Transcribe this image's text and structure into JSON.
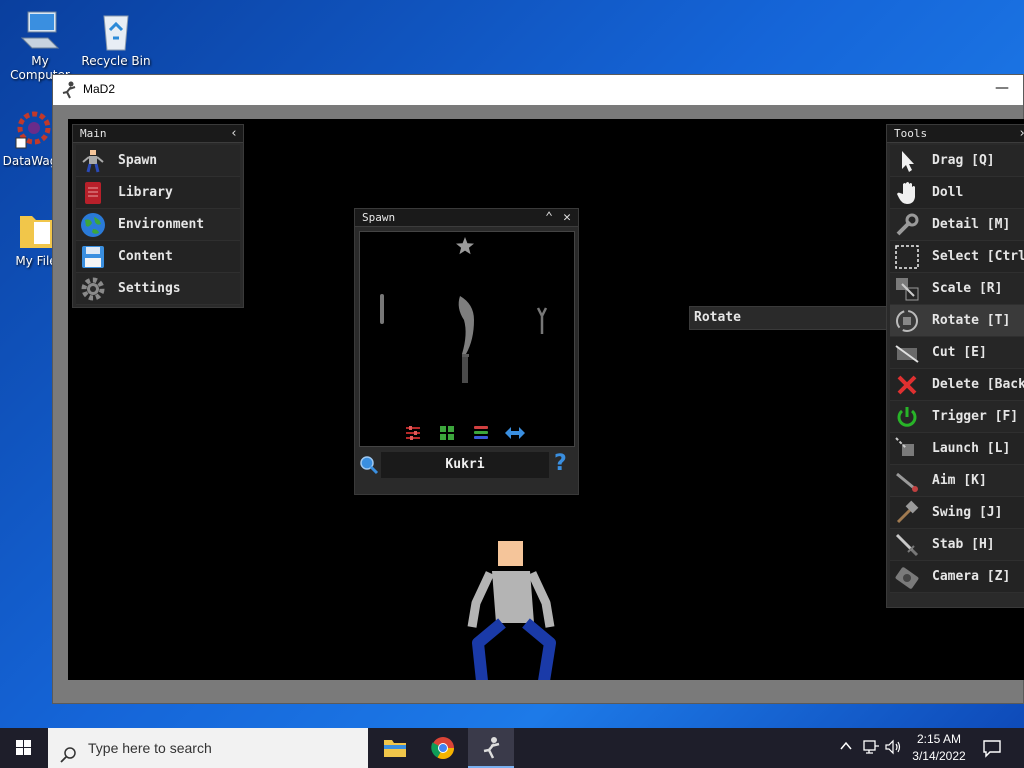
{
  "desktop": {
    "icons": [
      {
        "label": "My Computer",
        "icon": "computer-icon"
      },
      {
        "label": "Recycle Bin",
        "icon": "recycle-bin-icon"
      },
      {
        "label": "DataWag",
        "icon": "gear-shortcut-icon"
      },
      {
        "label": "My File",
        "icon": "folder-icon"
      }
    ]
  },
  "window": {
    "title": "MaD2",
    "minimize_glyph": "—"
  },
  "main_panel": {
    "title": "Main",
    "collapse_glyph": "‹",
    "items": [
      {
        "label": "Spawn",
        "icon": "ragdoll-icon"
      },
      {
        "label": "Library",
        "icon": "book-icon"
      },
      {
        "label": "Environment",
        "icon": "globe-icon"
      },
      {
        "label": "Content",
        "icon": "floppy-disk-icon"
      },
      {
        "label": "Settings",
        "icon": "gear-icon"
      }
    ]
  },
  "spawn_panel": {
    "title": "Spawn",
    "collapse_glyph": "⌃",
    "close_glyph": "✕",
    "search_value": "Kukri",
    "help_glyph": "?",
    "selected_item_icon": "kukri-icon",
    "toolbar_icons": [
      "filter-icon",
      "grid-icon",
      "list-icon",
      "swap-arrows-icon"
    ]
  },
  "tooltip": {
    "text": "Rotate"
  },
  "tools_panel": {
    "title": "Tools",
    "collapse_glyph": "›",
    "items": [
      {
        "label": "Drag [Q]",
        "icon": "cursor-icon"
      },
      {
        "label": "Doll",
        "icon": "hand-icon"
      },
      {
        "label": "Detail [M]",
        "icon": "wrench-icon"
      },
      {
        "label": "Select [Ctrl",
        "icon": "selection-box-icon"
      },
      {
        "label": "Scale [R]",
        "icon": "scale-icon"
      },
      {
        "label": "Rotate [T]",
        "icon": "rotate-icon"
      },
      {
        "label": "Cut [E]",
        "icon": "cut-icon"
      },
      {
        "label": "Delete [Back",
        "icon": "delete-x-icon"
      },
      {
        "label": "Trigger [F]",
        "icon": "power-icon"
      },
      {
        "label": "Launch [L]",
        "icon": "launch-icon"
      },
      {
        "label": "Aim [K]",
        "icon": "aim-icon"
      },
      {
        "label": "Swing [J]",
        "icon": "hammer-icon"
      },
      {
        "label": "Stab [H]",
        "icon": "sword-icon"
      },
      {
        "label": "Camera [Z]",
        "icon": "camera-icon"
      }
    ]
  },
  "taskbar": {
    "search_placeholder": "Type here to search",
    "time": "2:15 AM",
    "date": "3/14/2022",
    "apps": [
      "file-explorer-icon",
      "chrome-icon",
      "mad2-app-icon"
    ]
  },
  "colors": {
    "desktop_blue": "#1565d8",
    "panel_bg": "#2a2a2a",
    "canvas_bg": "#000000",
    "ragdoll_head": "#f5c59a",
    "ragdoll_shirt": "#b4b4b4",
    "ragdoll_pants": "#1a3aa8",
    "delete_red": "#e03030",
    "trigger_green": "#28b428"
  }
}
